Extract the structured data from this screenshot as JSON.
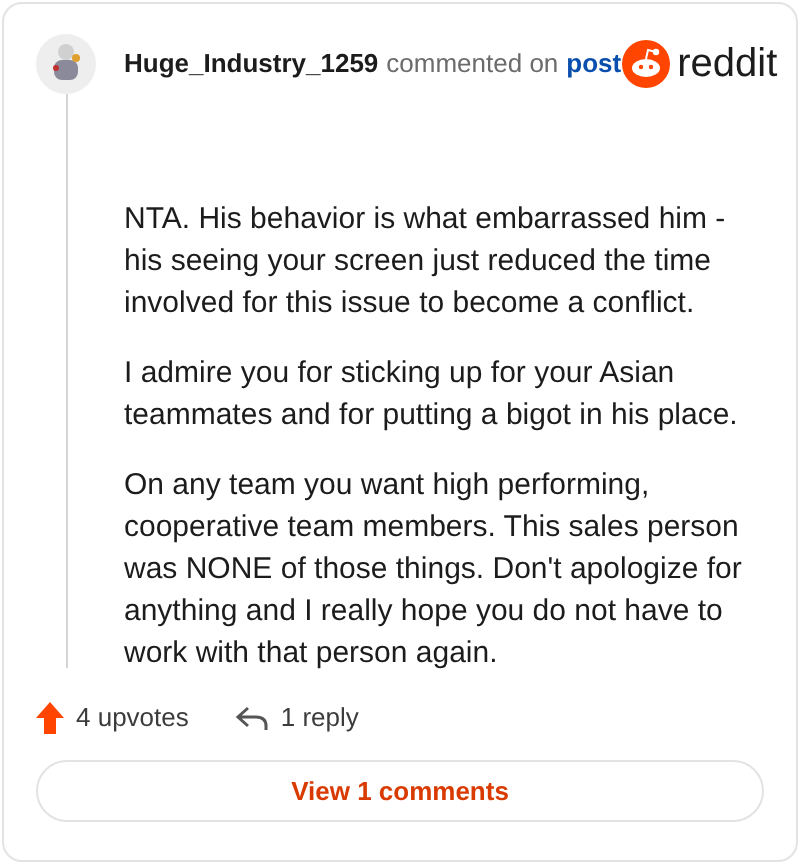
{
  "comment": {
    "author": "Huge_Industry_1259",
    "action": "commented on",
    "link": "post",
    "brand": "reddit",
    "paragraphs": [
      "NTA. His behavior is what embarrassed him - his seeing your screen just reduced the time involved for this issue to become a conflict.",
      "I admire you for sticking up for your Asian teammates and for putting a bigot in his place.",
      "On any team you want high performing, cooperative team members. This sales person was NONE of those things. Don't apologize for anything and I really hope you do not have to work with that person again."
    ],
    "upvotes": "4 upvotes",
    "replies": "1 reply"
  },
  "view_button": "View 1 comments"
}
